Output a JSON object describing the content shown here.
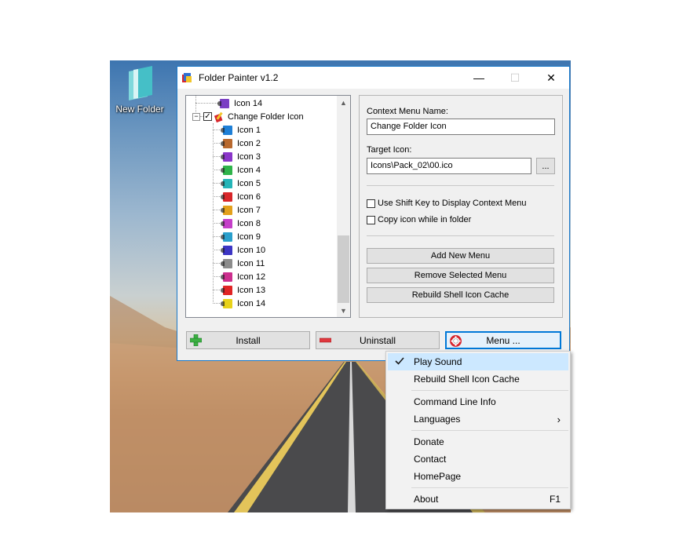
{
  "desktop": {
    "icon_label": "New Folder"
  },
  "window": {
    "title": "Folder Painter v1.2",
    "controls": {
      "minimize": "—",
      "maximize": "☐",
      "close": "✕"
    }
  },
  "tree": {
    "top_item": {
      "label": "Icon 14",
      "color": "#7b3fc4"
    },
    "parent": {
      "label": "Change Folder Icon",
      "checked": "✓",
      "expander": "−"
    },
    "children": [
      {
        "label": "Icon 1",
        "color": "#1e7fd6"
      },
      {
        "label": "Icon 2",
        "color": "#b8692e"
      },
      {
        "label": "Icon 3",
        "color": "#8a35c9"
      },
      {
        "label": "Icon 4",
        "color": "#2fb34a"
      },
      {
        "label": "Icon 5",
        "color": "#25b5b8"
      },
      {
        "label": "Icon 6",
        "color": "#d8262a"
      },
      {
        "label": "Icon 7",
        "color": "#e3a01b"
      },
      {
        "label": "Icon 8",
        "color": "#c53fc9"
      },
      {
        "label": "Icon 9",
        "color": "#2a9fcc"
      },
      {
        "label": "Icon 10",
        "color": "#3c35c4"
      },
      {
        "label": "Icon 11",
        "color": "#8c8c8c"
      },
      {
        "label": "Icon 12",
        "color": "#cc2f8e"
      },
      {
        "label": "Icon 13",
        "color": "#e02424"
      },
      {
        "label": "Icon 14",
        "color": "#e8d21a"
      }
    ],
    "scroll_up": "▲",
    "scroll_down": "▼"
  },
  "settings": {
    "context_menu_name_label": "Context Menu Name:",
    "context_menu_name_value": "Change Folder Icon",
    "target_icon_label": "Target Icon:",
    "target_icon_value": "Icons\\Pack_02\\00.ico",
    "browse_label": "...",
    "shift_key_label": "Use Shift Key to Display Context Menu",
    "copy_icon_label": "Copy icon while in folder",
    "add_menu_label": "Add New Menu",
    "remove_menu_label": "Remove Selected Menu",
    "rebuild_cache_label": "Rebuild Shell Icon Cache"
  },
  "bottom_buttons": {
    "install": "Install",
    "uninstall": "Uninstall",
    "menu": "Menu ..."
  },
  "context_menu": {
    "items": [
      {
        "label": "Play Sound",
        "checked": true
      },
      {
        "label": "Rebuild Shell Icon Cache"
      },
      {
        "label": "Command Line Info"
      },
      {
        "label": "Languages",
        "submenu": "›"
      },
      {
        "label": "Donate"
      },
      {
        "label": "Contact"
      },
      {
        "label": "HomePage"
      },
      {
        "label": "About",
        "shortcut": "F1"
      }
    ]
  },
  "colors": {
    "accent": "#0078d7",
    "window_border": "#1979ca",
    "install_icon": "#3cb043",
    "uninstall_icon": "#e0383e"
  }
}
